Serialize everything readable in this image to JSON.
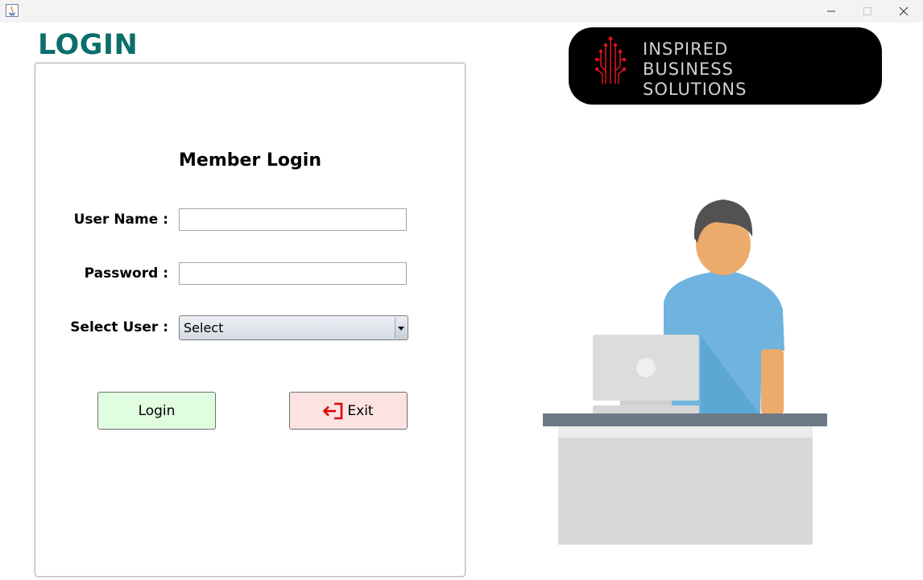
{
  "window": {
    "controls": [
      "minimize-icon",
      "maximize-icon",
      "close-icon"
    ]
  },
  "page": {
    "title": "LOGIN"
  },
  "form": {
    "heading": "Member Login",
    "username_label": "User Name :",
    "username_value": "",
    "password_label": "Password :",
    "password_value": "",
    "select_user_label": "Select User :",
    "select_user_value": "Select",
    "login_button": "Login",
    "exit_button": "Exit"
  },
  "logo": {
    "lines": [
      "INSPIRED",
      "BUSINESS",
      "SOLUTIONS"
    ]
  },
  "colors": {
    "title": "#0b6e6a",
    "login_button_bg": "#e0fde0",
    "exit_button_bg": "#fde2e2",
    "exit_icon": "#e00000",
    "logo_bg": "#000000",
    "logo_mark": "#e0141e",
    "shirt": "#6fb3de",
    "skin": "#ecab6d",
    "hair": "#525252",
    "desk_top": "#6c7885"
  }
}
